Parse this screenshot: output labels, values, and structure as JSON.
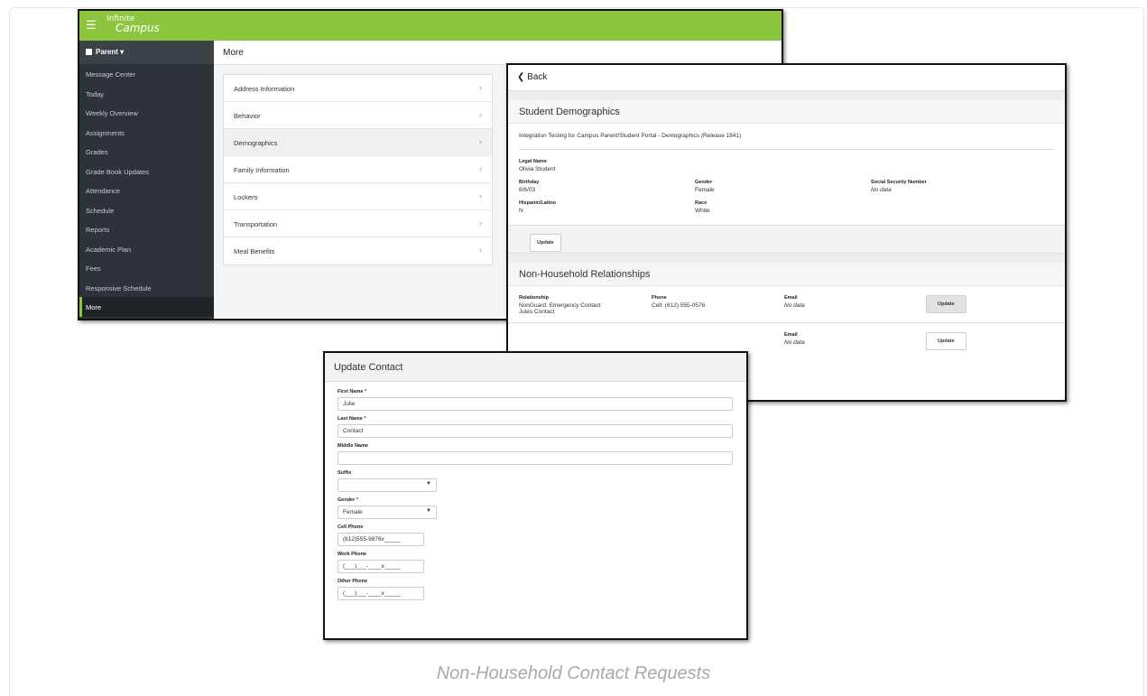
{
  "caption": "Non-Household Contact Requests",
  "app": {
    "logo_line1": "Infinite",
    "logo_line2": "Campus",
    "role_label": "Parent",
    "nav": [
      "Message Center",
      "Today",
      "Weekly Overview",
      "Assignments",
      "Grades",
      "Grade Book Updates",
      "Attendance",
      "Schedule",
      "Reports",
      "Academic Plan",
      "Fees",
      "Responsive Schedule",
      "More"
    ],
    "active_nav": "More",
    "page_title": "More",
    "more_items": [
      "Address Information",
      "Behavior",
      "Demographics",
      "Family Information",
      "Lockers",
      "Transportation",
      "Meal Benefits"
    ],
    "selected_more_item": "Demographics",
    "accent_color": "#8cc63f"
  },
  "demographics": {
    "back_label": "Back",
    "section_title": "Student Demographics",
    "description": "Integration Testing for Campus Parent/Student Portal - Demographics (Release 1841)",
    "legal_name_label": "Legal Name",
    "legal_name": "Olivia Student",
    "birthday_label": "Birthday",
    "birthday": "8/6/03",
    "gender_label": "Gender",
    "gender": "Female",
    "ssn_label": "Social Security Number",
    "ssn": "No data",
    "hispanic_label": "Hispanic/Latino",
    "hispanic": "N",
    "race_label": "Race",
    "race": "White",
    "update_label": "Update"
  },
  "non_household": {
    "title": "Non-Household Relationships",
    "row1": {
      "relationship_label": "Relationship",
      "relationship": "NonGuard: Emergency Contact",
      "name": "Jules Contact",
      "phone_label": "Phone",
      "phone": "Cell: (612) 555-0576",
      "email_label": "Email",
      "email": "No data",
      "update_label": "Update"
    },
    "row2": {
      "email_label": "Email",
      "email": "No data",
      "update_label": "Update"
    }
  },
  "update_contact": {
    "title": "Update Contact",
    "first_name_label": "First Name",
    "first_name": "Julie",
    "last_name_label": "Last Name",
    "last_name": "Contact",
    "middle_name_label": "Middle Name",
    "middle_name": "",
    "suffix_label": "Suffix",
    "suffix": "",
    "gender_label": "Gender",
    "gender": "Female",
    "cell_phone_label": "Cell Phone",
    "cell_phone": "(612)555-9876x_____",
    "work_phone_label": "Work Phone",
    "work_phone": "(___)___-____x_____",
    "other_phone_label": "Other Phone",
    "other_phone": "(___)___-____x_____",
    "required_mark": "*"
  }
}
